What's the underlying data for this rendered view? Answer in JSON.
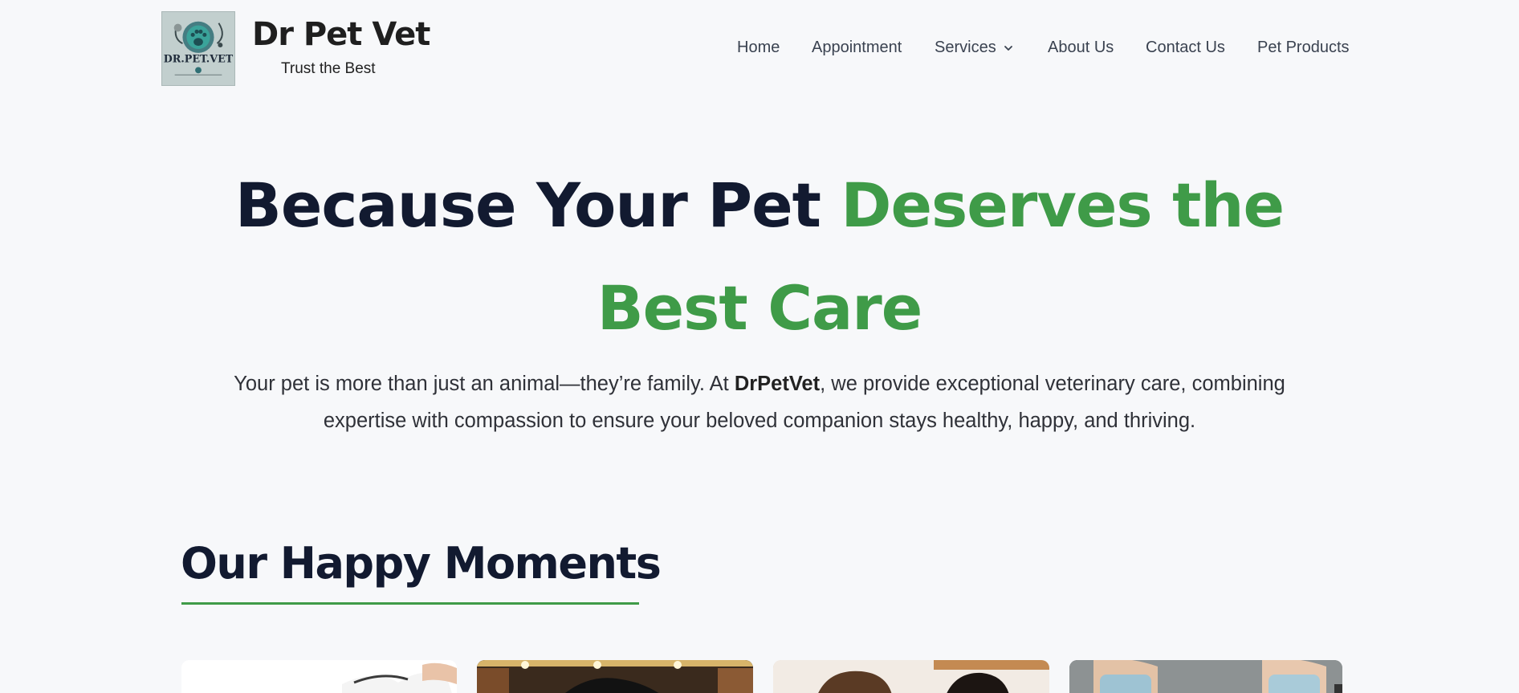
{
  "header": {
    "brand_title": "Dr Pet Vet",
    "tagline": "Trust the Best",
    "logo_icon": "paw-stethoscope-logo",
    "logo_text": "DR.PET.VET"
  },
  "nav": {
    "items": [
      {
        "label": "Home"
      },
      {
        "label": "Appointment"
      },
      {
        "label": "Services",
        "icon": "chevron-down-icon"
      },
      {
        "label": "About Us"
      },
      {
        "label": "Contact Us"
      },
      {
        "label": "Pet Products"
      }
    ]
  },
  "hero": {
    "title_part1": "Because Your Pet ",
    "title_part2": "Deserves the",
    "title_line2": "Best Care",
    "subtitle_before": "Your pet is more than just an animal—they’re family. At ",
    "subtitle_brand": "DrPetVet",
    "subtitle_after": ", we provide exceptional veterinary care, combining expertise with compassion to ensure your beloved companion stays healthy, happy, and thriving."
  },
  "section": {
    "title": "Our Happy Moments"
  },
  "colors": {
    "accent_green": "#3f9b48",
    "heading_navy": "#121a30",
    "background": "#f7f8fa"
  }
}
